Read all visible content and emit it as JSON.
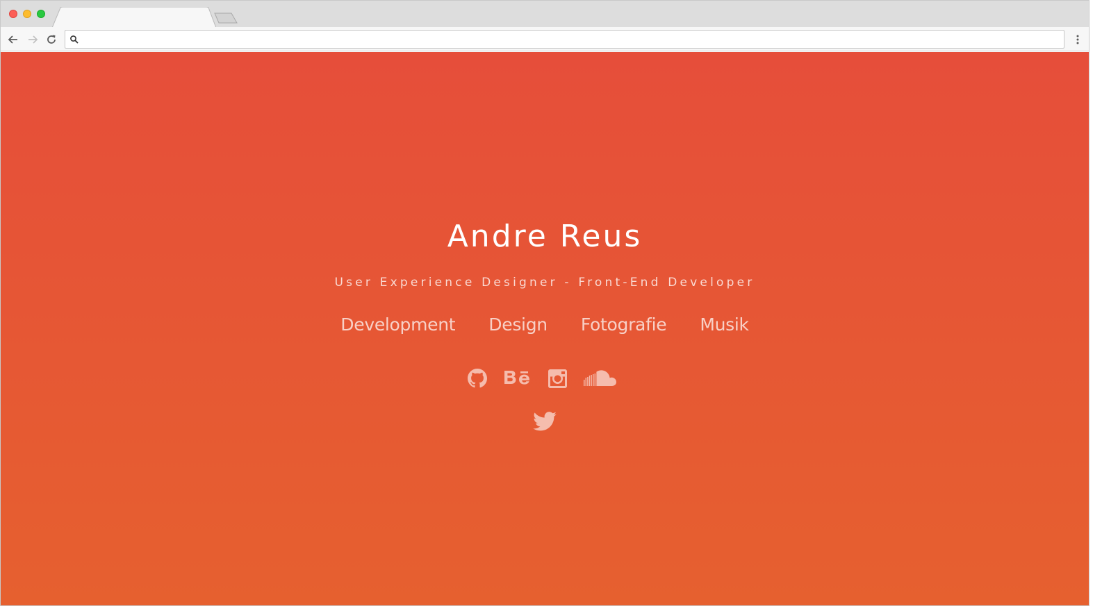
{
  "browser": {
    "url_value": "",
    "icons": [
      "back-icon",
      "forward-icon",
      "reload-icon",
      "search-icon",
      "menu-dots-icon"
    ]
  },
  "hero": {
    "name": "Andre Reus",
    "subtitle": "User Experience Designer - Front-End Developer"
  },
  "nav": {
    "items": [
      {
        "label": "Development"
      },
      {
        "label": "Design"
      },
      {
        "label": "Fotografie"
      },
      {
        "label": "Musik"
      }
    ]
  },
  "social": {
    "icons": [
      "github-icon",
      "behance-icon",
      "instagram-icon",
      "soundcloud-icon",
      "twitter-icon"
    ]
  },
  "colors": {
    "gradient_top": "#e64e3a",
    "gradient_bottom": "#e6602f",
    "text": "#ffffff"
  }
}
